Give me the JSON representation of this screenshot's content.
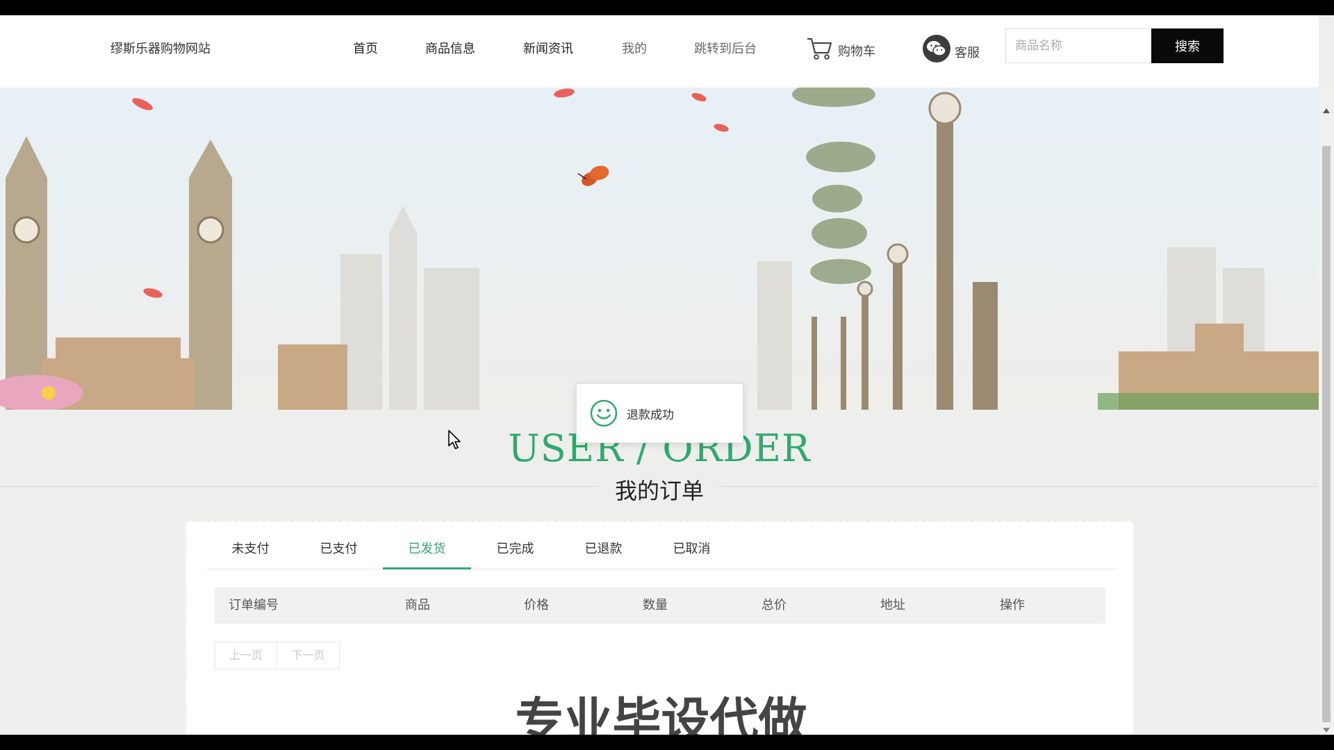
{
  "header": {
    "site_title": "缪斯乐器购物网站",
    "nav": [
      {
        "label": "首页"
      },
      {
        "label": "商品信息"
      },
      {
        "label": "新闻资讯"
      },
      {
        "label": "我的"
      },
      {
        "label": "跳转到后台"
      }
    ],
    "cart_label": "购物车",
    "service_label": "客服",
    "search_placeholder": "商品名称",
    "search_button": "搜索"
  },
  "toast": {
    "message": "退款成功",
    "icon": "smile-icon"
  },
  "section": {
    "title_en": "USER / ORDER",
    "title_cn": "我的订单"
  },
  "tabs": [
    {
      "label": "未支付"
    },
    {
      "label": "已支付"
    },
    {
      "label": "已发货",
      "active": true
    },
    {
      "label": "已完成"
    },
    {
      "label": "已退款"
    },
    {
      "label": "已取消"
    }
  ],
  "table": {
    "columns": [
      "订单编号",
      "商品",
      "价格",
      "数量",
      "总价",
      "地址",
      "操作"
    ]
  },
  "pager": {
    "prev": "上一页",
    "next": "下一页"
  },
  "watermark": "专业毕设代做",
  "colors": {
    "accent": "#2eaa6c",
    "search_button_bg": "#0a0a0a"
  }
}
